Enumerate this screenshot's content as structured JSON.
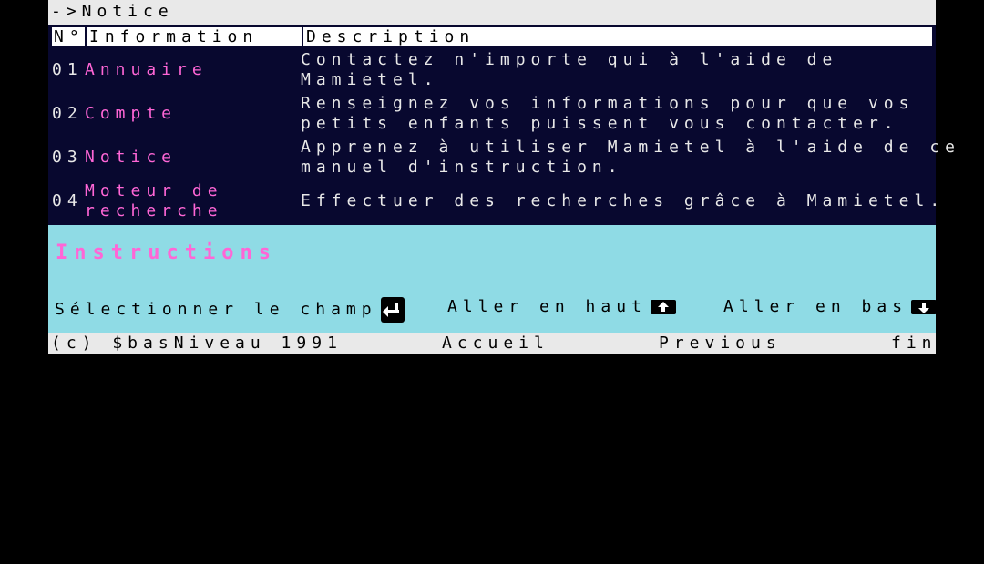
{
  "breadcrumb": "->Notice",
  "table": {
    "headers": {
      "num": "N°",
      "info": "Information",
      "desc": "Description"
    },
    "rows": [
      {
        "num": "01",
        "info": [
          "Annuaire"
        ],
        "desc": [
          "Contactez n'importe qui à l'aide de",
          "Mamietel."
        ]
      },
      {
        "num": "02",
        "info": [
          "Compte"
        ],
        "desc": [
          "Renseignez vos informations pour que vos",
          "petits enfants puissent vous contacter."
        ]
      },
      {
        "num": "03",
        "info": [
          "Notice"
        ],
        "desc": [
          "Apprenez à utiliser Mamietel à l'aide de ce",
          "manuel d'instruction."
        ]
      },
      {
        "num": "04",
        "info": [
          "Moteur de",
          "recherche"
        ],
        "desc": [
          "Effectuer des recherches grâce à Mamietel."
        ]
      }
    ]
  },
  "instructions": {
    "title": "Instructions",
    "select": "Sélectionner le champ",
    "up": "Aller en haut",
    "down": "Aller en bas"
  },
  "footer": {
    "copyright": "(c) $basNiveau 1991",
    "home": "Accueil",
    "previous": "Previous",
    "end": "fin"
  },
  "colors": {
    "link": "#ff66d6",
    "table_bg": "#08082f",
    "help_bg": "#8fdbe5",
    "bar_bg": "#e9e9e9"
  }
}
